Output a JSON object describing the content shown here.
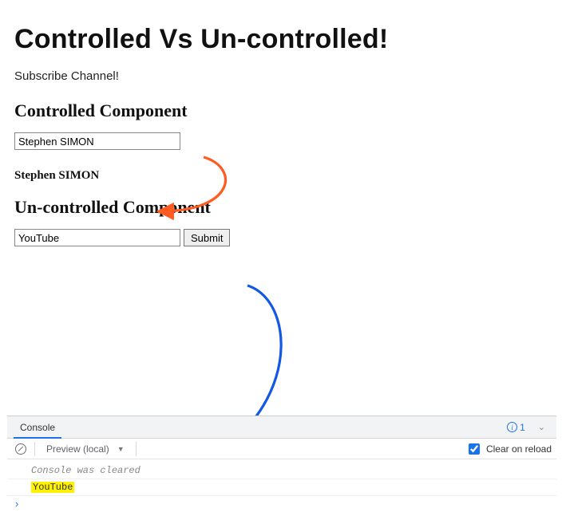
{
  "title": "Controlled Vs Un-controlled!",
  "subtitle": "Subscribe Channel!",
  "controlled": {
    "heading": "Controlled Component",
    "value": "Stephen SIMON",
    "echo": "Stephen SIMON"
  },
  "uncontrolled": {
    "heading": "Un-controlled Component",
    "value": "YouTube",
    "submit_label": "Submit"
  },
  "devtools": {
    "tab_label": "Console",
    "info_count": "1",
    "context": "Preview (local)",
    "clear_on_reload_label": "Clear on reload",
    "cleared_msg": "Console was cleared",
    "log_value": "YouTube",
    "prompt": "›"
  }
}
